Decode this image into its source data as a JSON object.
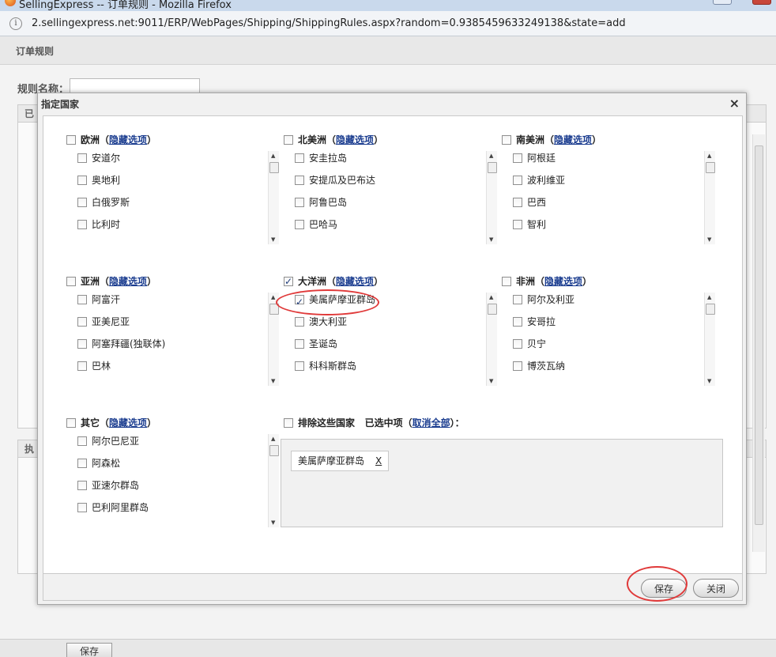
{
  "browser": {
    "title": "SellingExpress -- 订单规则 - Mozilla Firefox",
    "url": "2.sellingexpress.net:9011/ERP/WebPages/Shipping/ShippingRules.aspx?random=0.9385459633249138&state=add"
  },
  "page": {
    "breadcrumb": "订单规则",
    "rule_name_label": "规则名称：",
    "panel1_title": "已",
    "panel2_title": "执",
    "save_label": "保存"
  },
  "dialog": {
    "title": "指定国家",
    "close_glyph": "×",
    "hide_label": "隐藏选项",
    "regions": [
      {
        "name": "欧洲",
        "checked": false,
        "items": [
          {
            "label": "安道尔",
            "checked": false
          },
          {
            "label": "奥地利",
            "checked": false
          },
          {
            "label": "白俄罗斯",
            "checked": false
          },
          {
            "label": "比利时",
            "checked": false
          }
        ]
      },
      {
        "name": "北美洲",
        "checked": false,
        "items": [
          {
            "label": "安圭拉岛",
            "checked": false
          },
          {
            "label": "安提瓜及巴布达",
            "checked": false
          },
          {
            "label": "阿鲁巴岛",
            "checked": false
          },
          {
            "label": "巴哈马",
            "checked": false
          }
        ]
      },
      {
        "name": "南美洲",
        "checked": false,
        "items": [
          {
            "label": "阿根廷",
            "checked": false
          },
          {
            "label": "波利维亚",
            "checked": false
          },
          {
            "label": "巴西",
            "checked": false
          },
          {
            "label": "智利",
            "checked": false
          }
        ]
      },
      {
        "name": "亚洲",
        "checked": false,
        "items": [
          {
            "label": "阿富汗",
            "checked": false
          },
          {
            "label": "亚美尼亚",
            "checked": false
          },
          {
            "label": "阿塞拜疆(独联体)",
            "checked": false
          },
          {
            "label": "巴林",
            "checked": false
          }
        ]
      },
      {
        "name": "大洋洲",
        "checked": true,
        "items": [
          {
            "label": "美属萨摩亚群岛",
            "checked": true
          },
          {
            "label": "澳大利亚",
            "checked": false
          },
          {
            "label": "圣诞岛",
            "checked": false
          },
          {
            "label": "科科斯群岛",
            "checked": false
          }
        ]
      },
      {
        "name": "非洲",
        "checked": false,
        "items": [
          {
            "label": "阿尔及利亚",
            "checked": false
          },
          {
            "label": "安哥拉",
            "checked": false
          },
          {
            "label": "贝宁",
            "checked": false
          },
          {
            "label": "博茨瓦纳",
            "checked": false
          }
        ]
      },
      {
        "name": "其它",
        "checked": false,
        "items": [
          {
            "label": "阿尔巴尼亚",
            "checked": false
          },
          {
            "label": "阿森松",
            "checked": false
          },
          {
            "label": "亚速尔群岛",
            "checked": false
          },
          {
            "label": "巴利阿里群岛",
            "checked": false
          }
        ]
      }
    ],
    "exclude_label": "排除这些国家",
    "selected_label": "已选中项",
    "clear_all_label": "取消全部",
    "selected_items": [
      {
        "label": "美属萨摩亚群岛",
        "remove_label": "X"
      }
    ],
    "save_label": "保存",
    "close_label": "关闭"
  },
  "colors": {
    "link": "#1a3c8f",
    "annotation": "#e03a3a"
  }
}
